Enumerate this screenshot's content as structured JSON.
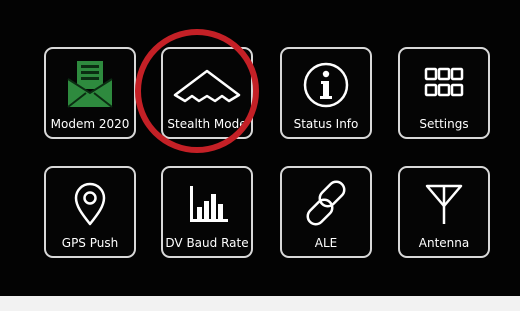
{
  "colors": {
    "background": "#030303",
    "tile_border": "#d8d8d8",
    "label_text": "#ffffff",
    "modem_icon_green": "#2e8a3e",
    "highlight_ring": "#c42026"
  },
  "highlight": {
    "target": "Stealth Mode"
  },
  "tiles": [
    {
      "label": "Modem 2020",
      "icon": "envelope-icon"
    },
    {
      "label": "Stealth Mode",
      "icon": "stealth-bomber-icon"
    },
    {
      "label": "Status Info",
      "icon": "info-icon"
    },
    {
      "label": "Settings",
      "icon": "grid-icon"
    },
    {
      "label": "GPS Push",
      "icon": "location-pin-icon"
    },
    {
      "label": "DV Baud Rate",
      "icon": "bar-chart-icon"
    },
    {
      "label": "ALE",
      "icon": "chain-link-icon"
    },
    {
      "label": "Antenna",
      "icon": "antenna-icon"
    }
  ]
}
